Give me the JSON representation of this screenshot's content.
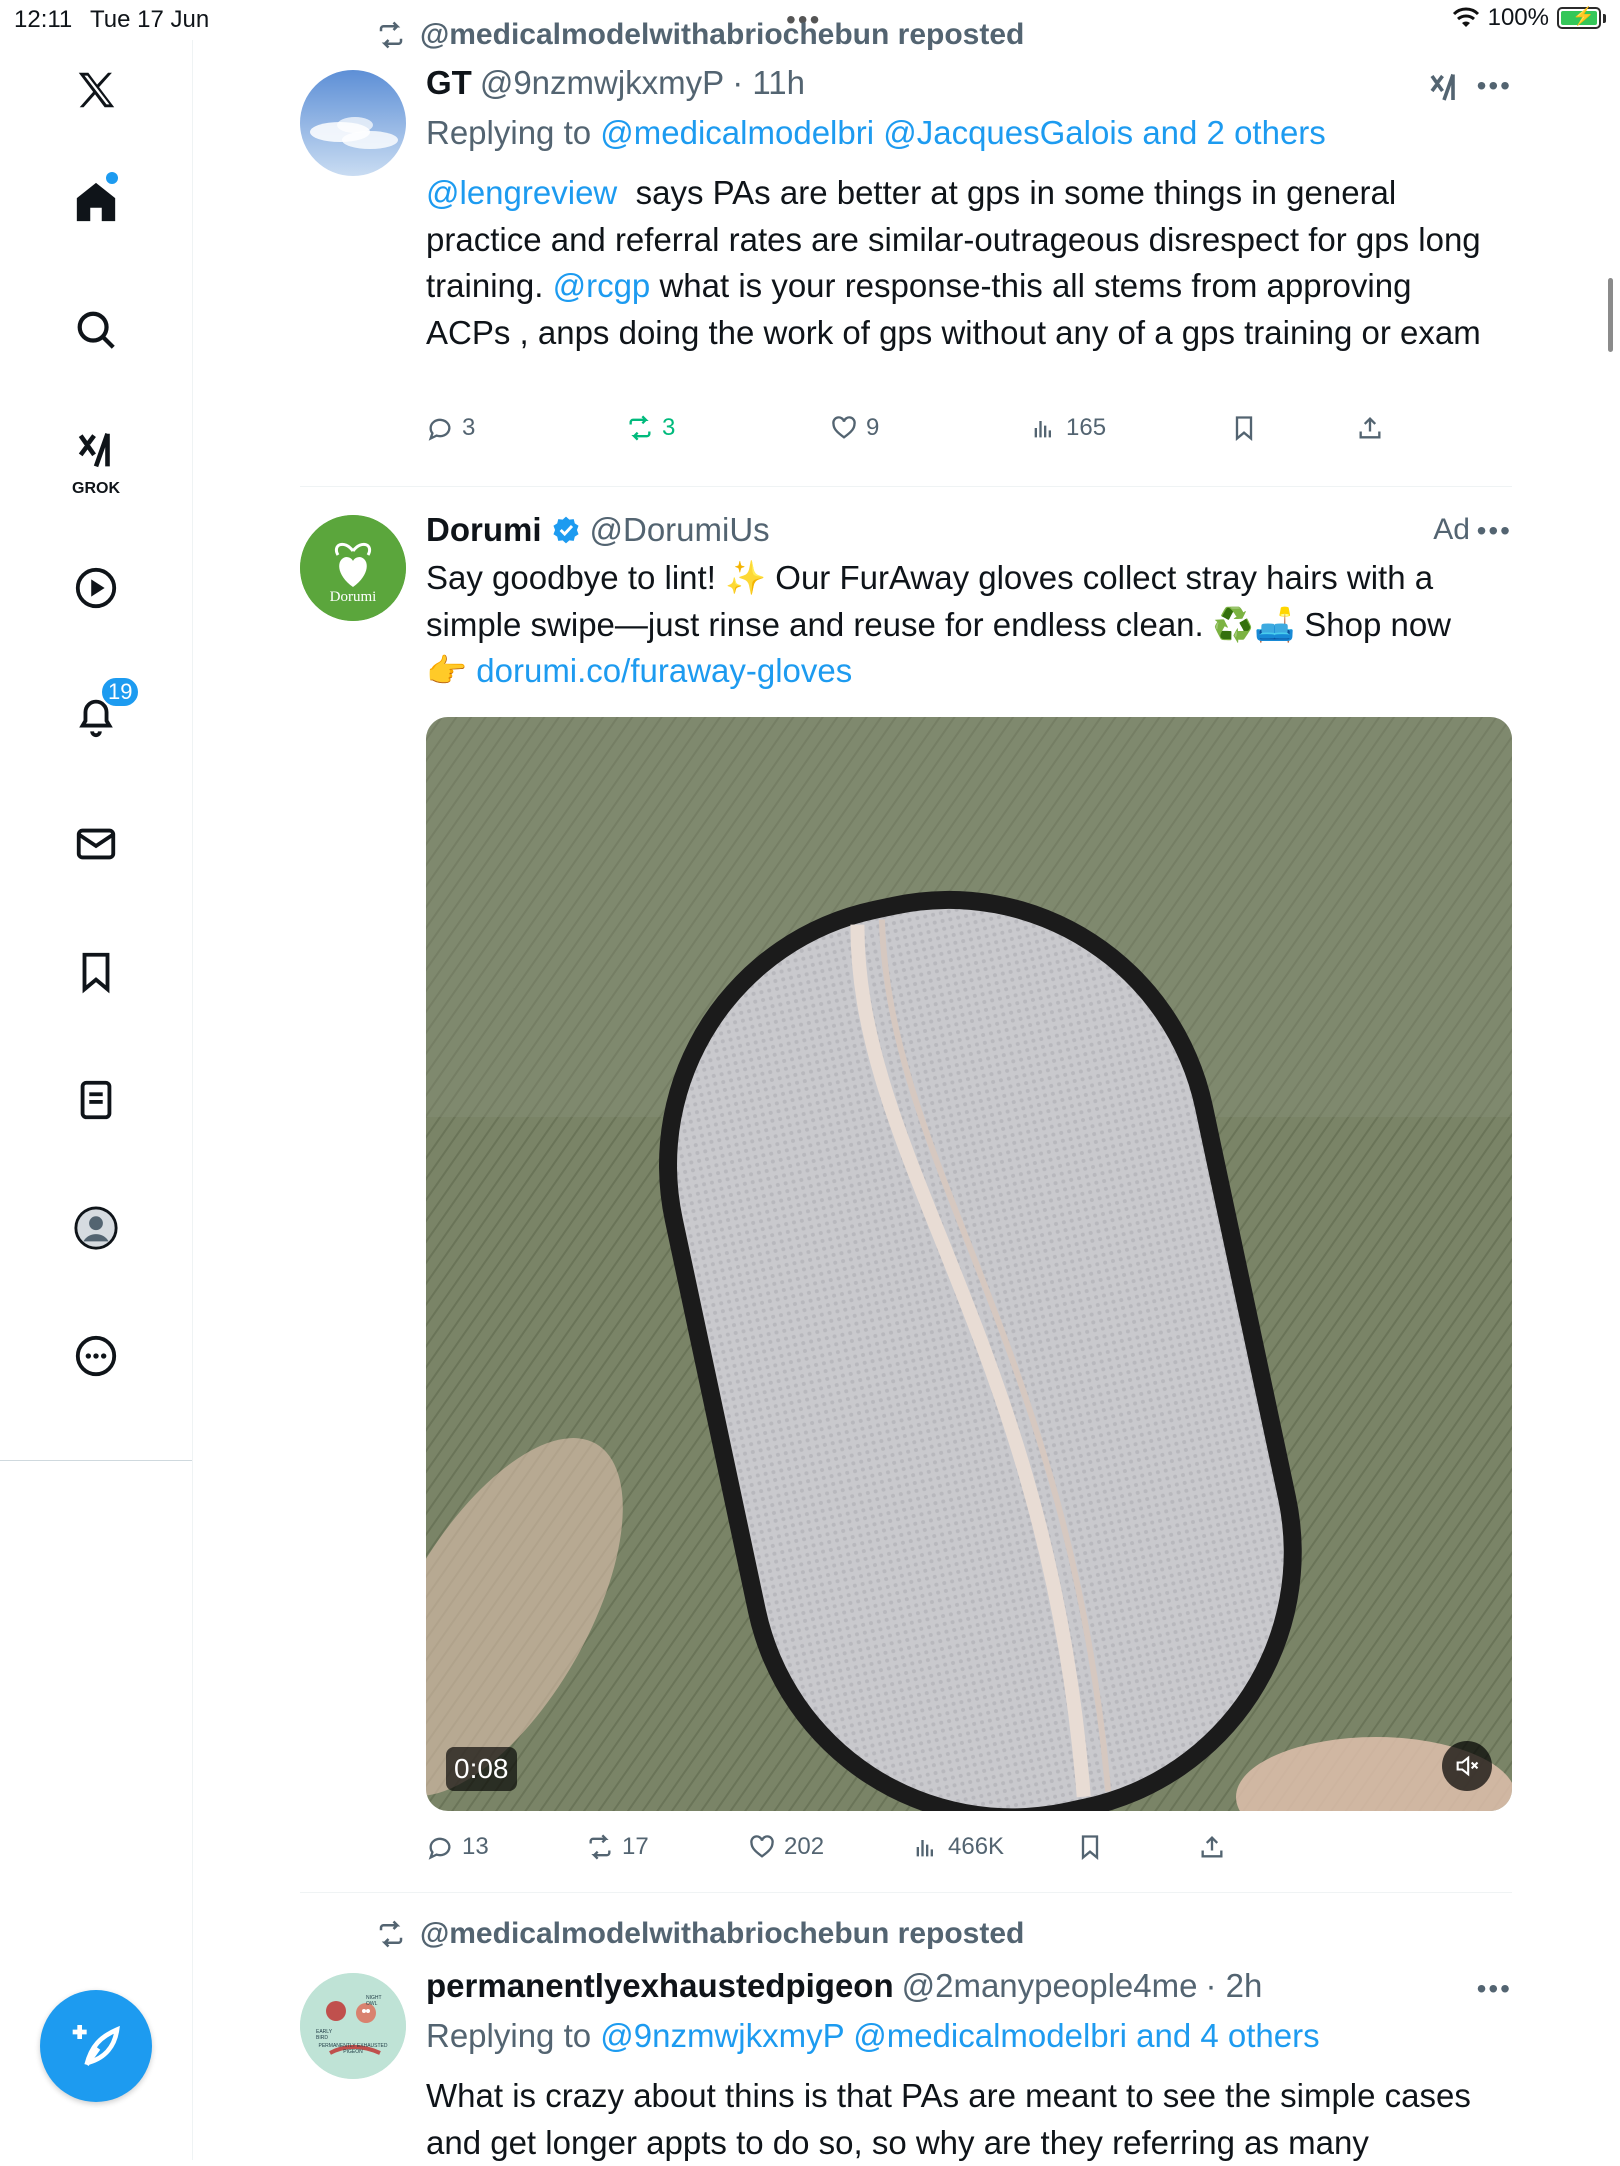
{
  "status_bar": {
    "time": "12:11",
    "date": "Tue 17 Jun",
    "battery": "100%"
  },
  "sidebar": {
    "items": [
      {
        "name": "x-logo"
      },
      {
        "name": "home",
        "has_dot": true
      },
      {
        "name": "search"
      },
      {
        "name": "grok",
        "label": "GROK"
      },
      {
        "name": "video"
      },
      {
        "name": "notifications",
        "badge": "19"
      },
      {
        "name": "messages"
      },
      {
        "name": "bookmarks"
      },
      {
        "name": "lists"
      },
      {
        "name": "profile"
      },
      {
        "name": "more"
      }
    ],
    "compose_icon": "quill-plus-icon"
  },
  "posts": [
    {
      "repost_by": "@medicalmodelwithabriochebun reposted",
      "name": "GT",
      "handle": "@9nzmwjkxmyP",
      "time": "· 11h",
      "replying_prefix": "Replying to",
      "replying_to": "@medicalmodelbri @JacquesGalois and 2 others",
      "text_parts": {
        "m1": "@lengreview",
        "t1": "  says PAs are better at gps in some things in general practice and referral rates are similar-outrageous disrespect for gps long training. ",
        "m2": "@rcgp",
        "t2": " what is your response-this all stems from approving ACPs , anps doing the work of gps without any of a gps training or exam"
      },
      "stats": {
        "replies": "3",
        "reposts": "3",
        "likes": "9",
        "views": "165"
      }
    },
    {
      "name": "Dorumi",
      "handle": "@DorumiUs",
      "ad_label": "Ad",
      "verified": true,
      "avatar_text": "Dorumi",
      "text": "Say goodbye to lint! ✨ Our FurAway gloves collect stray hairs with a simple swipe—just rinse and reuse for endless clean. ♻️🛋️ Shop now",
      "link_prefix": "👉",
      "link": "dorumi.co/furaway-gloves",
      "video_time": "0:08",
      "stats": {
        "replies": "13",
        "reposts": "17",
        "likes": "202",
        "views": "466K"
      }
    },
    {
      "repost_by": "@medicalmodelwithabriochebun reposted",
      "name": "permanentlyexhaustedpigeon",
      "handle": "@2manypeople4me",
      "time": "· 2h",
      "replying_prefix": "Replying to",
      "replying_to": "@9nzmwjkxmyP @medicalmodelbri and 4 others",
      "avatar_labels": {
        "a": "NIGHT OWL",
        "b": "EARLY BIRD",
        "c": "PERMANENTLY EXHAUSTED PIGEON"
      },
      "text": "What is crazy about thins is that PAs are meant to see the simple cases and get longer appts to do so, so why are they referring as many"
    }
  ],
  "colors": {
    "accent": "#1d9bf0",
    "repost_green": "#00ba7c",
    "muted": "#536471"
  }
}
